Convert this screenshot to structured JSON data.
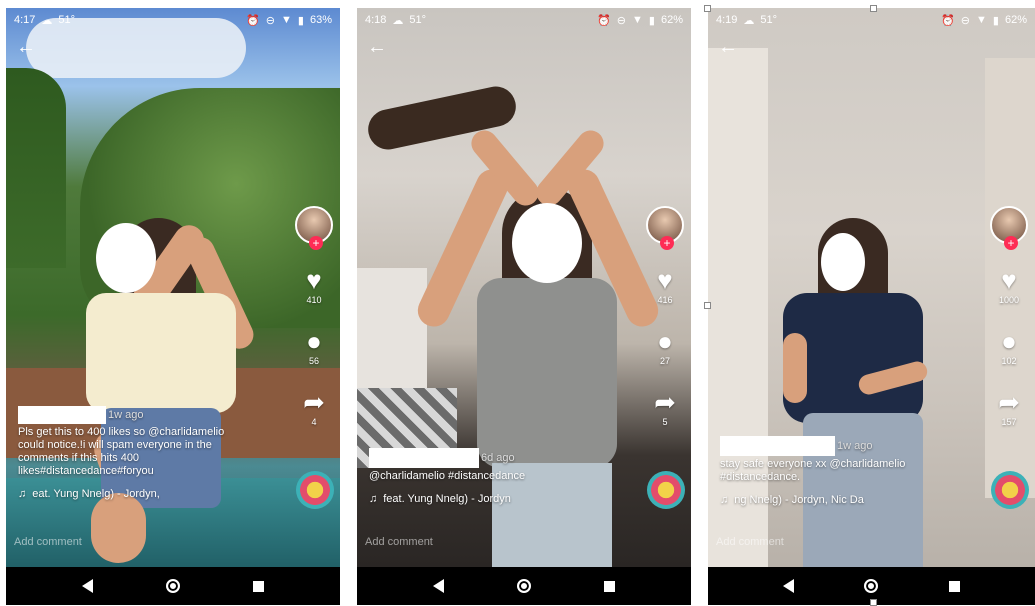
{
  "phones": [
    {
      "status": {
        "time": "4:17",
        "temp": "51°",
        "battery": "63%"
      },
      "time_ago": "1w ago",
      "caption": "Pls get this to 400 likes so @charlidamelio could notice.!i will spam everyone in the comments if this hits 400 likes#distancedance#foryou",
      "music": "eat. Yung Nnelg) - Jordyn,",
      "likes": "410",
      "comments": "56",
      "shares": "4",
      "add_comment": "Add comment"
    },
    {
      "status": {
        "time": "4:18",
        "temp": "51°",
        "battery": "62%"
      },
      "time_ago": "6d ago",
      "caption": "@charlidamelio #distancedance",
      "music": "feat. Yung Nnelg) - Jordyn",
      "likes": "416",
      "comments": "27",
      "shares": "5",
      "add_comment": "Add comment"
    },
    {
      "status": {
        "time": "4:19",
        "temp": "51°",
        "battery": "62%"
      },
      "time_ago": "1w ago",
      "caption": "stay safe everyone xx @charlidamelio #distancedance.",
      "music": "ng Nnelg) - Jordyn, Nic Da",
      "likes": "1000",
      "comments": "102",
      "shares": "157",
      "add_comment": "Add comment"
    }
  ],
  "icons": {
    "status_weather": "cloud-icon",
    "status_alarm": "alarm-icon",
    "status_dnd": "dnd-icon",
    "status_wifi": "wifi-icon",
    "status_battery": "battery-icon",
    "back": "back-arrow-icon",
    "like": "heart-icon",
    "comment": "comment-icon",
    "share": "share-icon",
    "music": "music-note-icon"
  },
  "colors": {
    "accent": "#fe2c55"
  }
}
